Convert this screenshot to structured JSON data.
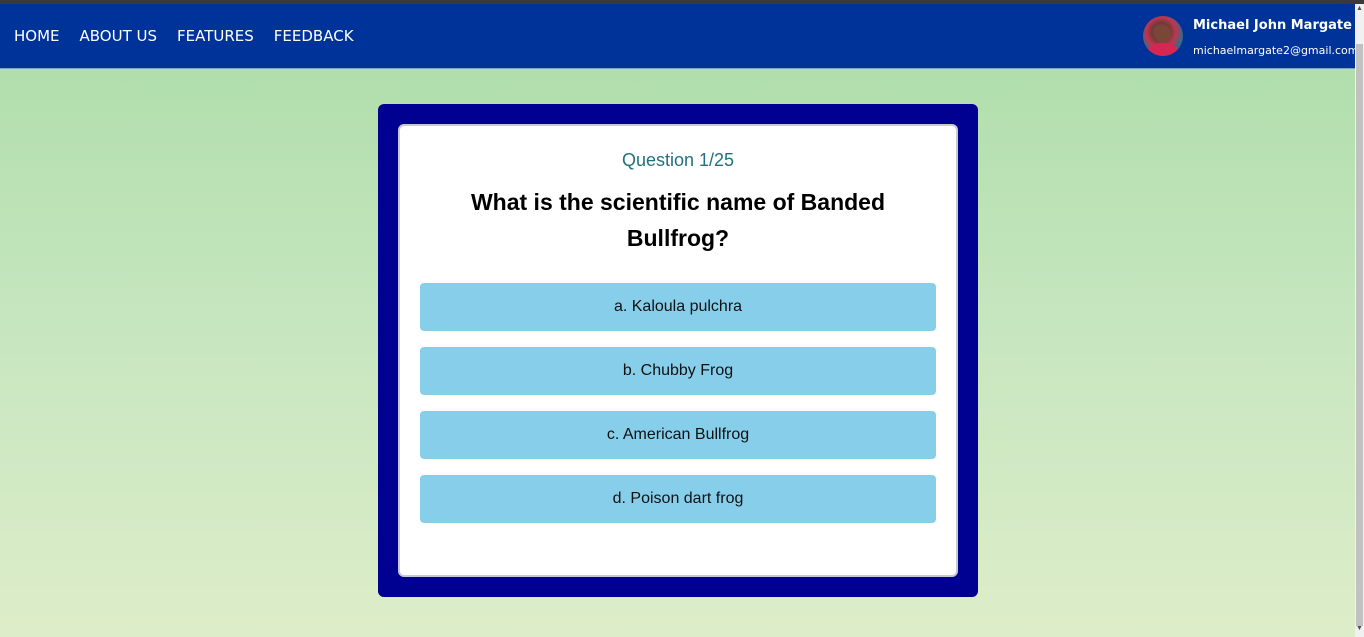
{
  "nav": {
    "items": [
      {
        "label": "HOME"
      },
      {
        "label": "ABOUT US"
      },
      {
        "label": "FEATURES"
      },
      {
        "label": "FEEDBACK"
      }
    ]
  },
  "user": {
    "name": "Michael John Margate",
    "email": "michaelmargate2@gmail.com"
  },
  "quiz": {
    "counter": "Question 1/25",
    "question": "What is the scientific name of Banded Bullfrog?",
    "options": [
      {
        "label": "a. Kaloula pulchra"
      },
      {
        "label": "b. Chubby Frog"
      },
      {
        "label": "c. American Bullfrog"
      },
      {
        "label": "d. Poison dart frog"
      }
    ]
  },
  "colors": {
    "navbar": "#003399",
    "frame": "#000091",
    "option_bg": "#87ceeb",
    "counter_text": "#237080",
    "page_gradient_top": "#abdca7",
    "page_gradient_bottom": "#ddedc9"
  }
}
